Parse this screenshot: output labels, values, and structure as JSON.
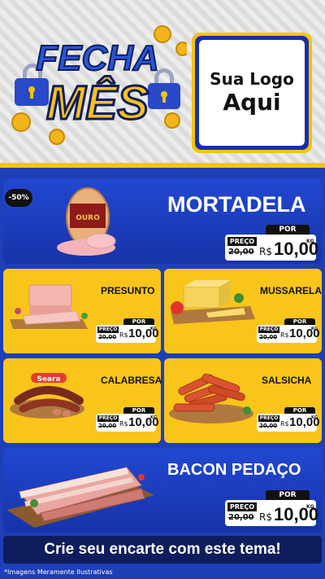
{
  "header": {
    "title_line1": "FECHA",
    "title_line2": "MÊS",
    "logo_line1": "Sua Logo",
    "logo_line2": "Aqui"
  },
  "featured": {
    "discount": "-50%",
    "product_label": "OURO",
    "name": "MORTADELA",
    "por": "POR",
    "preco": "PREÇO",
    "old_price": "20,00",
    "currency": "R$",
    "price": "10,00",
    "unit": "KG"
  },
  "products": [
    {
      "name": "PRESUNTO",
      "por": "POR",
      "preco": "PREÇO",
      "old_price": "20,00",
      "currency": "R$",
      "price": "10,00",
      "unit": "KG"
    },
    {
      "name": "MUSSARELA",
      "por": "POR",
      "preco": "PREÇO",
      "old_price": "20,00",
      "currency": "R$",
      "price": "10,00",
      "unit": "KG"
    },
    {
      "name": "CALABRESA",
      "brand": "Seara",
      "por": "POR",
      "preco": "PREÇO",
      "old_price": "20,00",
      "currency": "R$",
      "price": "10,00",
      "unit": "KG"
    },
    {
      "name": "SALSICHA",
      "por": "POR",
      "preco": "PREÇO",
      "old_price": "20,00",
      "currency": "R$",
      "price": "10,00",
      "unit": "KG"
    }
  ],
  "bacon": {
    "name": "BACON PEDAÇO",
    "por": "POR",
    "preco": "PREÇO",
    "old_price": "20,00",
    "currency": "R$",
    "price": "10,00",
    "unit": "KG"
  },
  "banner": "Crie seu encarte com este tema!",
  "disclaimer": "*Imagens Meramente Ilustrativas",
  "colors": {
    "blue": "#1d3fb8",
    "yellow": "#f9c51b",
    "dark": "#111111"
  }
}
